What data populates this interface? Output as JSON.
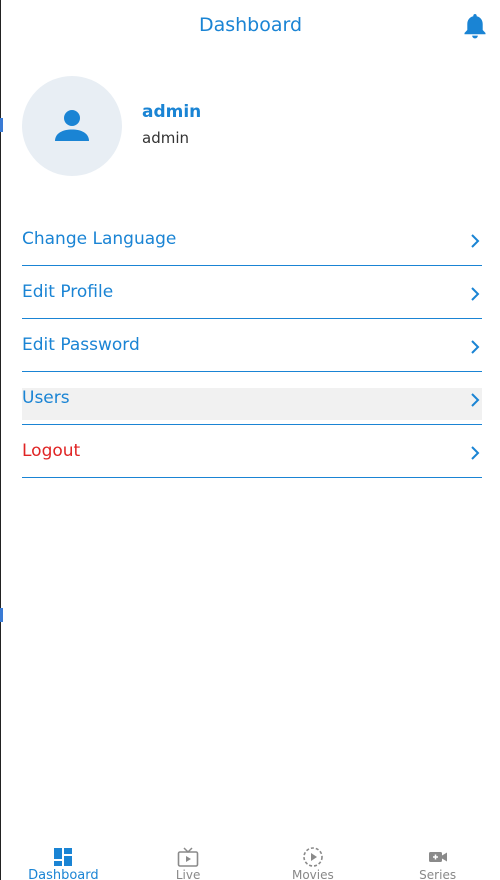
{
  "header": {
    "title": "Dashboard",
    "bell_icon": "bell-icon"
  },
  "profile": {
    "name": "admin",
    "role": "admin",
    "avatar_icon": "person-icon"
  },
  "menu": {
    "items": [
      {
        "label": "Change Language"
      },
      {
        "label": "Edit Profile"
      },
      {
        "label": "Edit Password"
      },
      {
        "label": "Users"
      },
      {
        "label": "Logout"
      }
    ]
  },
  "nav": {
    "items": [
      {
        "label": "Dashboard",
        "icon": "dashboard-icon",
        "active": true
      },
      {
        "label": "Live",
        "icon": "tv-icon"
      },
      {
        "label": "Movies",
        "icon": "play-circle-icon"
      },
      {
        "label": "Series",
        "icon": "video-camera-icon"
      }
    ]
  },
  "colors": {
    "accent": "#1a84d4",
    "danger": "#e02424",
    "avatar_bg": "#e8eef4"
  }
}
